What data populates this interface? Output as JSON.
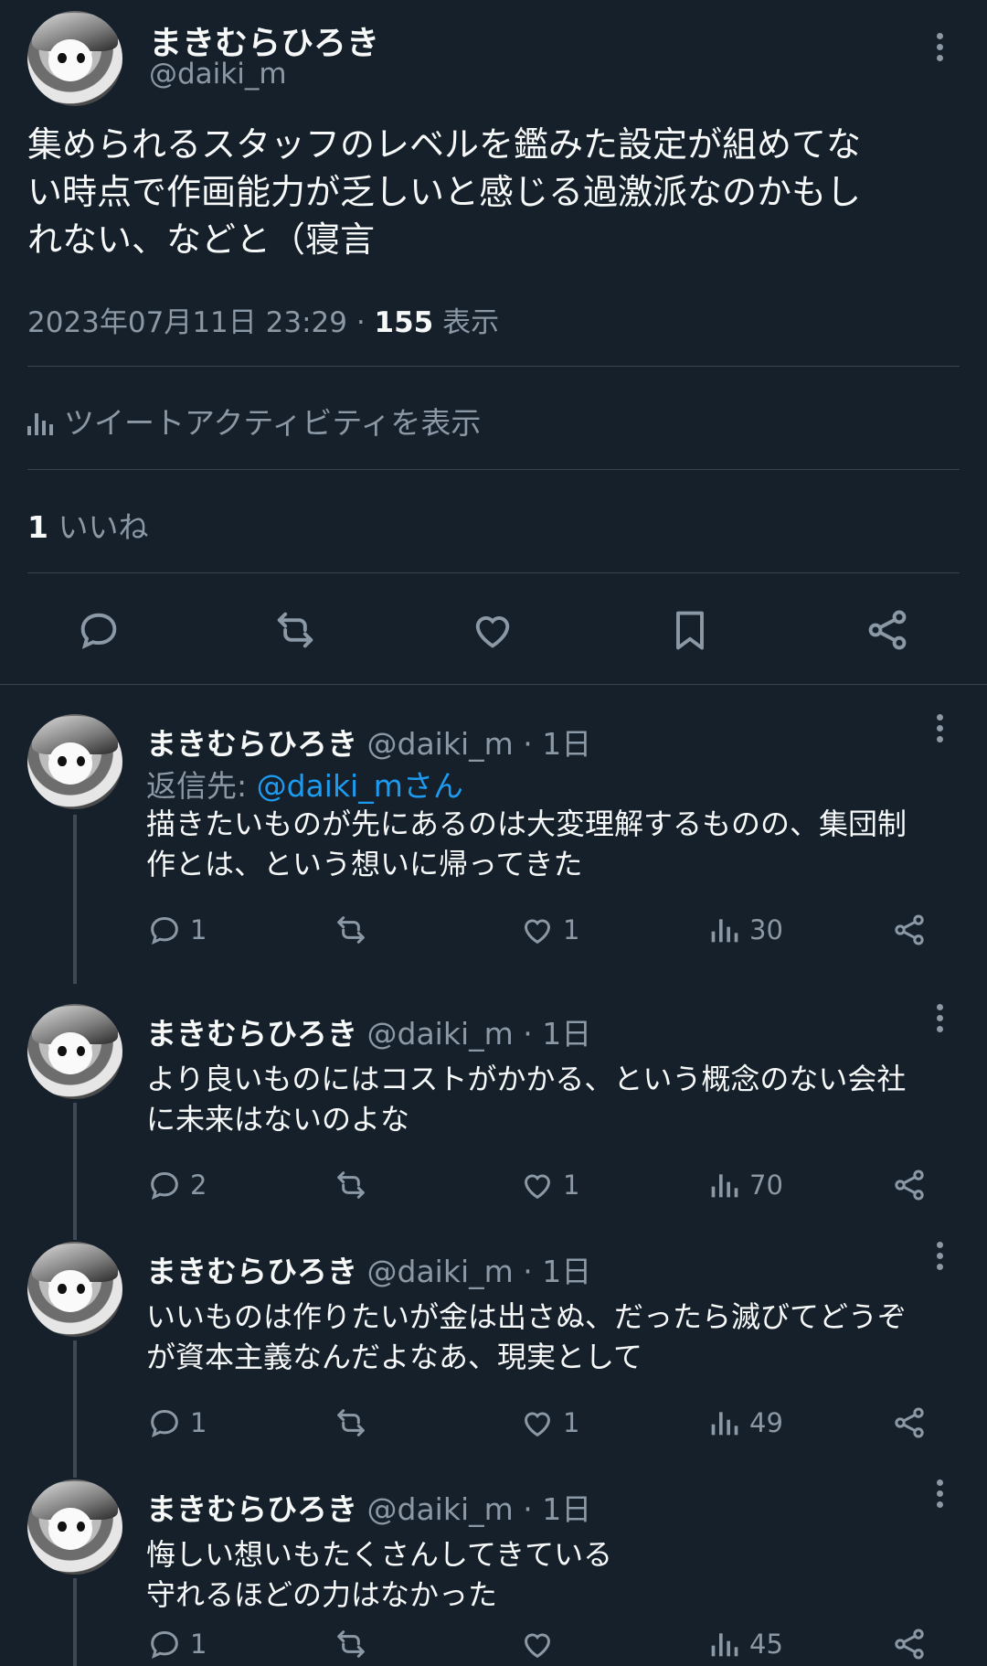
{
  "main_tweet": {
    "author_name": "まきむらひろき",
    "author_handle": "@daiki_m",
    "text": "集められるスタッフのレベルを鑑みた設定が組めてな\nい時点で作画能力が乏しいと感じる過激派なのかもし\nれない、などと（寝言",
    "timestamp": "2023年07月11日 23:29 · ",
    "views_count": "155",
    "views_label": " 表示",
    "activity_label": "ツイートアクティビティを表示",
    "likes_count": "1",
    "likes_label": " いいね",
    "actions": [
      "reply-icon",
      "retweet-icon",
      "like-icon",
      "bookmark-icon",
      "share-icon"
    ]
  },
  "replies": [
    {
      "author_name": "まきむらひろき",
      "author_handle": "@daiki_m",
      "time": "· 1日",
      "reply_to_prefix": "返信先: ",
      "reply_to_handle": "@daiki_mさん",
      "text": "描きたいものが先にあるのは大変理解するものの、集団制\n作とは、という想いに帰ってきた",
      "reply_count": "1",
      "retweet_count": "",
      "like_count": "1",
      "view_count": "30"
    },
    {
      "author_name": "まきむらひろき",
      "author_handle": "@daiki_m",
      "time": "· 1日",
      "text": "より良いものにはコストがかかる、という概念のない会社\nに未来はないのよな",
      "reply_count": "2",
      "retweet_count": "",
      "like_count": "1",
      "view_count": "70"
    },
    {
      "author_name": "まきむらひろき",
      "author_handle": "@daiki_m",
      "time": "· 1日",
      "text": "いいものは作りたいが金は出さぬ、だったら滅びてどうぞ\nが資本主義なんだよなあ、現実として",
      "reply_count": "1",
      "retweet_count": "",
      "like_count": "1",
      "view_count": "49"
    },
    {
      "author_name": "まきむらひろき",
      "author_handle": "@daiki_m",
      "time": "· 1日",
      "text": "悔しい想いもたくさんしてきている\n守れるほどの力はなかった",
      "reply_count": "1",
      "retweet_count": "",
      "like_count": "",
      "view_count": "45"
    }
  ],
  "colors": {
    "background": "#15202b",
    "text": "#f7f9f9",
    "secondary": "#8b98a5",
    "accent": "#1d9bf0",
    "divider": "#38444d"
  }
}
